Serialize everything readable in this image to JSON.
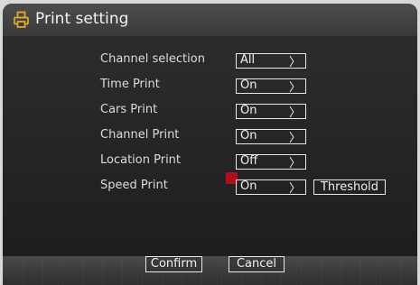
{
  "title": "Print setting",
  "icons": {
    "title": "printer-icon",
    "arrow": "chevron-right-icon",
    "marker": "record-marker-icon"
  },
  "settings": [
    {
      "label": "Channel selection",
      "value": "All"
    },
    {
      "label": "Time Print",
      "value": "On"
    },
    {
      "label": "Cars Print",
      "value": "On"
    },
    {
      "label": "Channel Print",
      "value": "On"
    },
    {
      "label": "Location Print",
      "value": "Off"
    },
    {
      "label": "Speed Print",
      "value": "On"
    }
  ],
  "arrow": "〉",
  "threshold_label": "Threshold",
  "footer": {
    "confirm_label": "Confirm",
    "cancel_label": "Cancel"
  },
  "colors": {
    "accent_icon": "#e0a92a",
    "marker": "#b00f1e"
  }
}
